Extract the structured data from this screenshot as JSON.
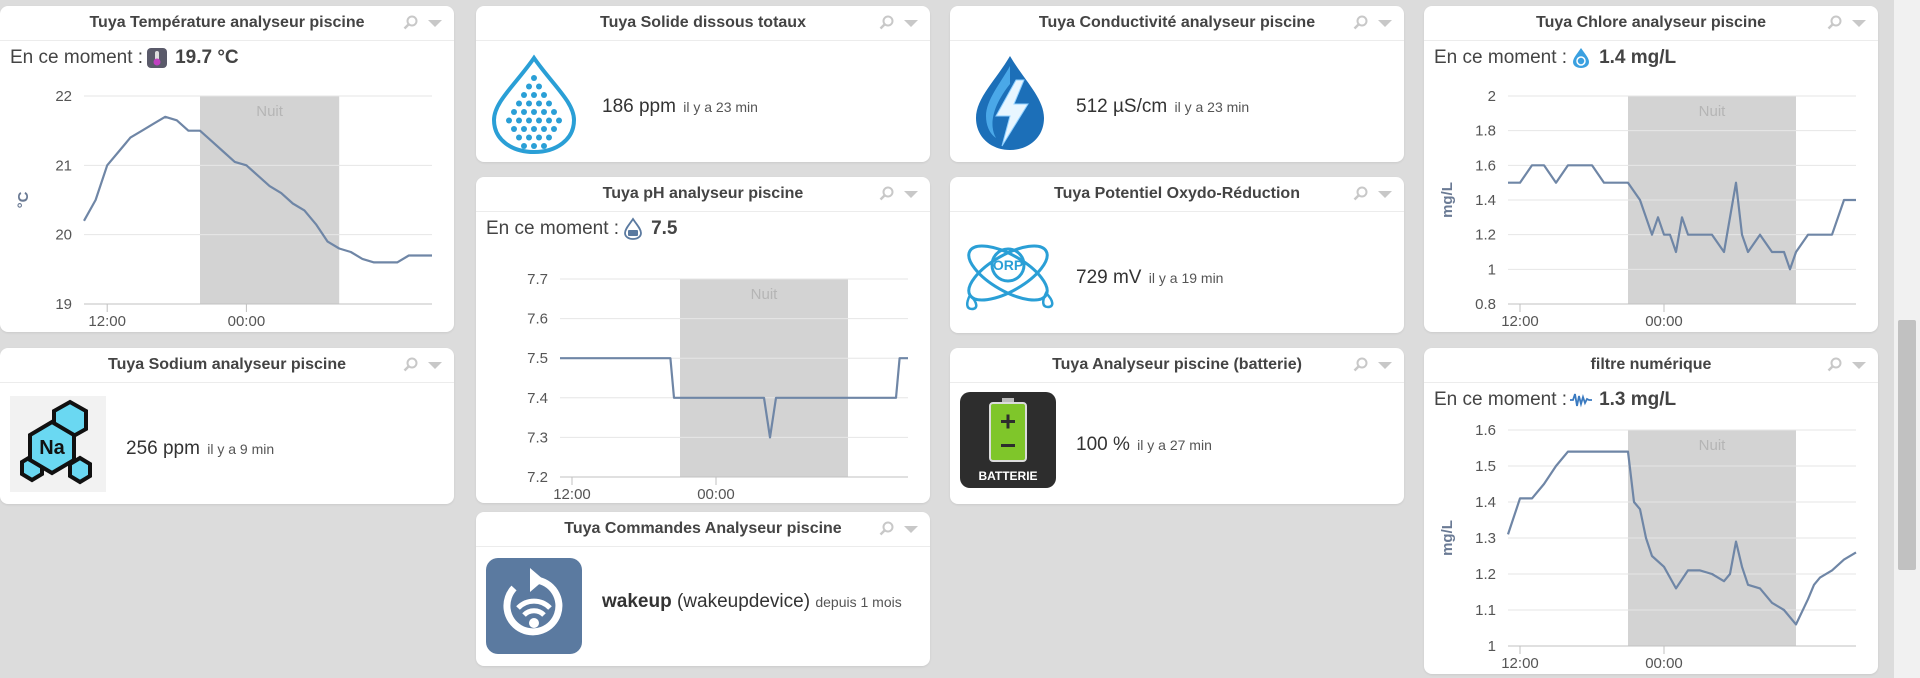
{
  "widgets": {
    "temperature": {
      "title": "Tuya Température analyseur piscine",
      "now_label": "En ce moment :",
      "now_value": "19.7 °C",
      "ylabel": "°C",
      "night_label": "Nuit",
      "x_ticks": [
        "12:00",
        "00:00"
      ],
      "y_ticks": [
        "22",
        "21",
        "20",
        "19"
      ]
    },
    "solids": {
      "title": "Tuya Solide dissous totaux",
      "value": "186 ppm",
      "ago": "il y a 23 min"
    },
    "conductivity": {
      "title": "Tuya Conductivité analyseur piscine",
      "value": "512 µS/cm",
      "ago": "il y a 23 min"
    },
    "chlorine": {
      "title": "Tuya Chlore analyseur piscine",
      "now_label": "En ce moment :",
      "now_value": "1.4 mg/L",
      "ylabel": "mg/L",
      "night_label": "Nuit",
      "x_ticks": [
        "12:00",
        "00:00"
      ],
      "y_ticks": [
        "2",
        "1.8",
        "1.6",
        "1.4",
        "1.2",
        "1",
        "0.8"
      ]
    },
    "ph": {
      "title": "Tuya pH analyseur piscine",
      "now_label": "En ce moment :",
      "now_value": "7.5",
      "night_label": "Nuit",
      "x_ticks": [
        "12:00",
        "00:00"
      ],
      "y_ticks": [
        "7.7",
        "7.6",
        "7.5",
        "7.4",
        "7.3",
        "7.2"
      ]
    },
    "orp": {
      "title": "Tuya Potentiel Oxydo-Réduction",
      "icon_text": "ORP",
      "value": "729 mV",
      "ago": "il y a 19 min"
    },
    "sodium": {
      "title": "Tuya Sodium analyseur piscine",
      "icon_text": "Na",
      "value": "256 ppm",
      "ago": "il y a 9 min"
    },
    "battery": {
      "title": "Tuya Analyseur piscine (batterie)",
      "icon_text": "BATTERIE",
      "value": "100 %",
      "ago": "il y a 27 min"
    },
    "commands": {
      "title": "Tuya Commandes Analyseur piscine",
      "name": "wakeup",
      "detail": "(wakeupdevice)",
      "ago": "depuis 1 mois"
    },
    "filter": {
      "title": "filtre numérique",
      "now_label": "En ce moment :",
      "now_value": "1.3 mg/L",
      "ylabel": "mg/L",
      "night_label": "Nuit",
      "x_ticks": [
        "12:00",
        "00:00"
      ],
      "y_ticks": [
        "1.6",
        "1.5",
        "1.4",
        "1.3",
        "1.2",
        "1.1",
        "1"
      ]
    }
  },
  "colors": {
    "line": "#6f86a6",
    "night_band": "#d3d3d3",
    "grid": "#e6e6e6",
    "icon_blue": "#2a9fd6",
    "cmd_tile": "#5b7aa0"
  },
  "chart_data": [
    {
      "type": "line",
      "title": "Tuya Température analyseur piscine",
      "ylabel": "°C",
      "ylim": [
        19,
        22
      ],
      "x_ticks": [
        "12:00",
        "00:00"
      ],
      "x_range": [
        -2,
        28
      ],
      "night": [
        8,
        20
      ],
      "x": [
        -2,
        -1,
        0,
        1,
        2,
        3,
        4,
        5,
        6,
        7,
        8,
        9,
        10,
        11,
        12,
        13,
        14,
        15,
        16,
        17,
        18,
        19,
        20,
        21,
        22,
        23,
        24,
        25,
        26,
        27,
        28
      ],
      "values": [
        20.2,
        20.5,
        21.0,
        21.2,
        21.4,
        21.5,
        21.6,
        21.7,
        21.65,
        21.5,
        21.5,
        21.35,
        21.2,
        21.05,
        21.0,
        20.85,
        20.7,
        20.6,
        20.45,
        20.35,
        20.15,
        19.9,
        19.8,
        19.75,
        19.65,
        19.6,
        19.6,
        19.6,
        19.7,
        19.7,
        19.7
      ]
    },
    {
      "type": "line",
      "title": "Tuya pH analyseur piscine",
      "ylim": [
        7.2,
        7.7
      ],
      "x_ticks": [
        "12:00",
        "00:00"
      ],
      "x_range": [
        -1,
        28
      ],
      "night": [
        9,
        23
      ],
      "x": [
        -1,
        0,
        2,
        4,
        6,
        8,
        8.2,
        8.5,
        10,
        12,
        14,
        16,
        16.5,
        17,
        18,
        20,
        22,
        24,
        26,
        27,
        27.3,
        28
      ],
      "values": [
        7.5,
        7.5,
        7.5,
        7.5,
        7.5,
        7.5,
        7.5,
        7.4,
        7.4,
        7.4,
        7.4,
        7.4,
        7.3,
        7.4,
        7.4,
        7.4,
        7.4,
        7.4,
        7.4,
        7.4,
        7.5,
        7.5
      ]
    },
    {
      "type": "line",
      "title": "Tuya Chlore analyseur piscine",
      "ylabel": "mg/L",
      "ylim": [
        0.8,
        2.0
      ],
      "x_ticks": [
        "12:00",
        "00:00"
      ],
      "x_range": [
        -1,
        28
      ],
      "night": [
        9,
        23
      ],
      "x": [
        -1,
        0,
        1,
        2,
        3,
        4,
        5,
        6,
        7,
        8,
        9,
        10,
        10.5,
        11,
        11.5,
        12,
        12.5,
        13,
        13.5,
        14,
        14.5,
        15,
        16,
        17,
        18,
        18.5,
        19,
        20,
        21,
        22,
        22.5,
        23,
        24,
        25,
        26,
        27,
        28
      ],
      "values": [
        1.5,
        1.5,
        1.6,
        1.6,
        1.5,
        1.6,
        1.6,
        1.6,
        1.5,
        1.5,
        1.5,
        1.4,
        1.3,
        1.2,
        1.3,
        1.2,
        1.2,
        1.1,
        1.3,
        1.2,
        1.2,
        1.2,
        1.2,
        1.1,
        1.5,
        1.2,
        1.1,
        1.2,
        1.1,
        1.1,
        1.0,
        1.1,
        1.2,
        1.2,
        1.2,
        1.4,
        1.4
      ]
    },
    {
      "type": "line",
      "title": "filtre numérique",
      "ylabel": "mg/L",
      "ylim": [
        1.0,
        1.6
      ],
      "x_ticks": [
        "12:00",
        "00:00"
      ],
      "x_range": [
        -1,
        28
      ],
      "night": [
        9,
        23
      ],
      "x": [
        -1,
        0,
        1,
        2,
        3,
        4,
        5,
        6,
        7,
        8,
        9,
        9.5,
        10,
        10.5,
        11,
        12,
        13,
        14,
        15,
        16,
        17,
        17.5,
        18,
        18.5,
        19,
        20,
        21,
        22,
        23,
        24,
        24.5,
        25,
        26,
        27,
        28
      ],
      "values": [
        1.31,
        1.41,
        1.41,
        1.45,
        1.5,
        1.54,
        1.54,
        1.54,
        1.54,
        1.54,
        1.54,
        1.4,
        1.38,
        1.3,
        1.25,
        1.22,
        1.16,
        1.21,
        1.21,
        1.2,
        1.18,
        1.2,
        1.29,
        1.22,
        1.17,
        1.16,
        1.12,
        1.1,
        1.06,
        1.13,
        1.17,
        1.19,
        1.21,
        1.24,
        1.26
      ]
    }
  ]
}
